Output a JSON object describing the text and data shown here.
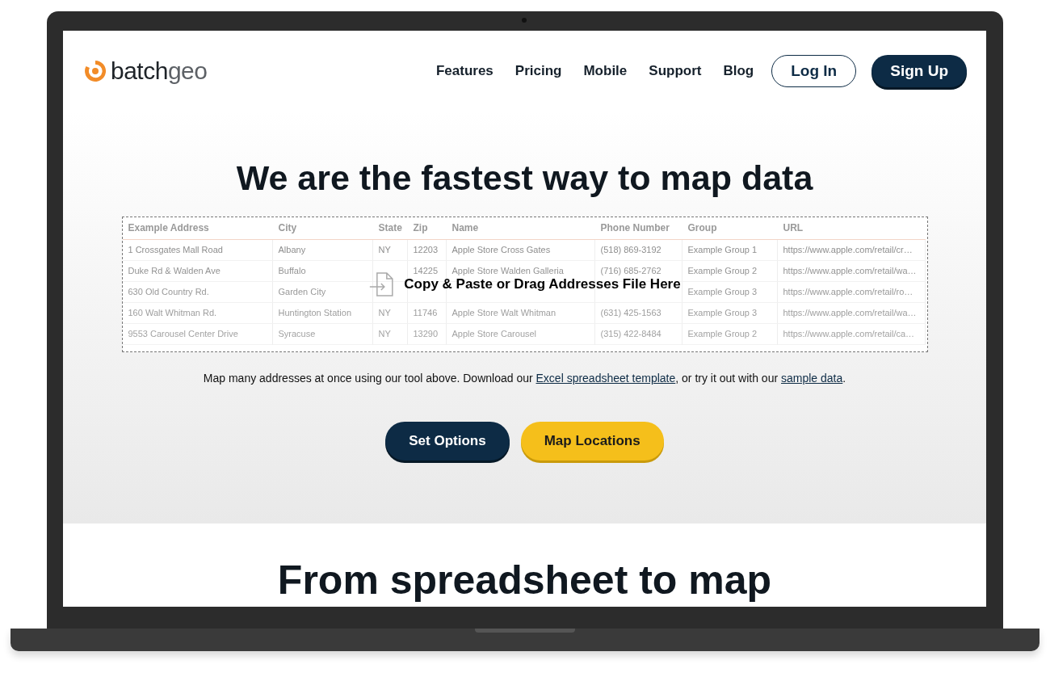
{
  "header": {
    "logo": {
      "first": "batch",
      "second": "geo"
    },
    "nav": [
      "Features",
      "Pricing",
      "Mobile",
      "Support",
      "Blog"
    ],
    "buttons": [
      {
        "label": "Log In",
        "kind": "outline"
      },
      {
        "label": "Sign Up",
        "kind": "solid"
      }
    ]
  },
  "hero": {
    "title": "We are the fastest way to map data",
    "table": {
      "columns": [
        "Example Address",
        "City",
        "State",
        "Zip",
        "Name",
        "Phone Number",
        "Group",
        "URL"
      ],
      "rows": [
        [
          "1 Crossgates Mall Road",
          "Albany",
          "NY",
          "12203",
          "Apple Store Cross Gates",
          "(518) 869-3192",
          "Example Group 1",
          "https://www.apple.com/retail/cr…"
        ],
        [
          "Duke Rd & Walden Ave",
          "Buffalo",
          null,
          "14225",
          "Apple Store Walden Galleria",
          "(716) 685-2762",
          "Example Group 2",
          "https://www.apple.com/retail/wa…"
        ],
        [
          "630 Old Country Rd.",
          "Garden City",
          null,
          null,
          null,
          null,
          "Example Group 3",
          "https://www.apple.com/retail/ro…"
        ],
        [
          "160 Walt Whitman Rd.",
          "Huntington Station",
          "NY",
          "11746",
          "Apple Store Walt Whitman",
          "(631) 425-1563",
          "Example Group 3",
          "https://www.apple.com/retail/wa…"
        ],
        [
          "9553 Carousel Center Drive",
          "Syracuse",
          "NY",
          "13290",
          "Apple Store Carousel",
          "(315) 422-8484",
          "Example Group 2",
          "https://www.apple.com/retail/ca…"
        ]
      ],
      "drop_hint": "Copy & Paste or Drag Addresses File Here"
    },
    "note": [
      {
        "kind": "text",
        "text": "Map many addresses at once using our tool above. Download our "
      },
      {
        "kind": "link",
        "text": "Excel spreadsheet template"
      },
      {
        "kind": "text",
        "text": ", or try it out with our "
      },
      {
        "kind": "link",
        "text": "sample data"
      },
      {
        "kind": "text",
        "text": "."
      }
    ],
    "buttons": [
      {
        "label": "Set Options",
        "kind": "solid"
      },
      {
        "label": "Map Locations",
        "kind": "accent"
      }
    ]
  },
  "section": {
    "title": "From spreadsheet to map"
  }
}
